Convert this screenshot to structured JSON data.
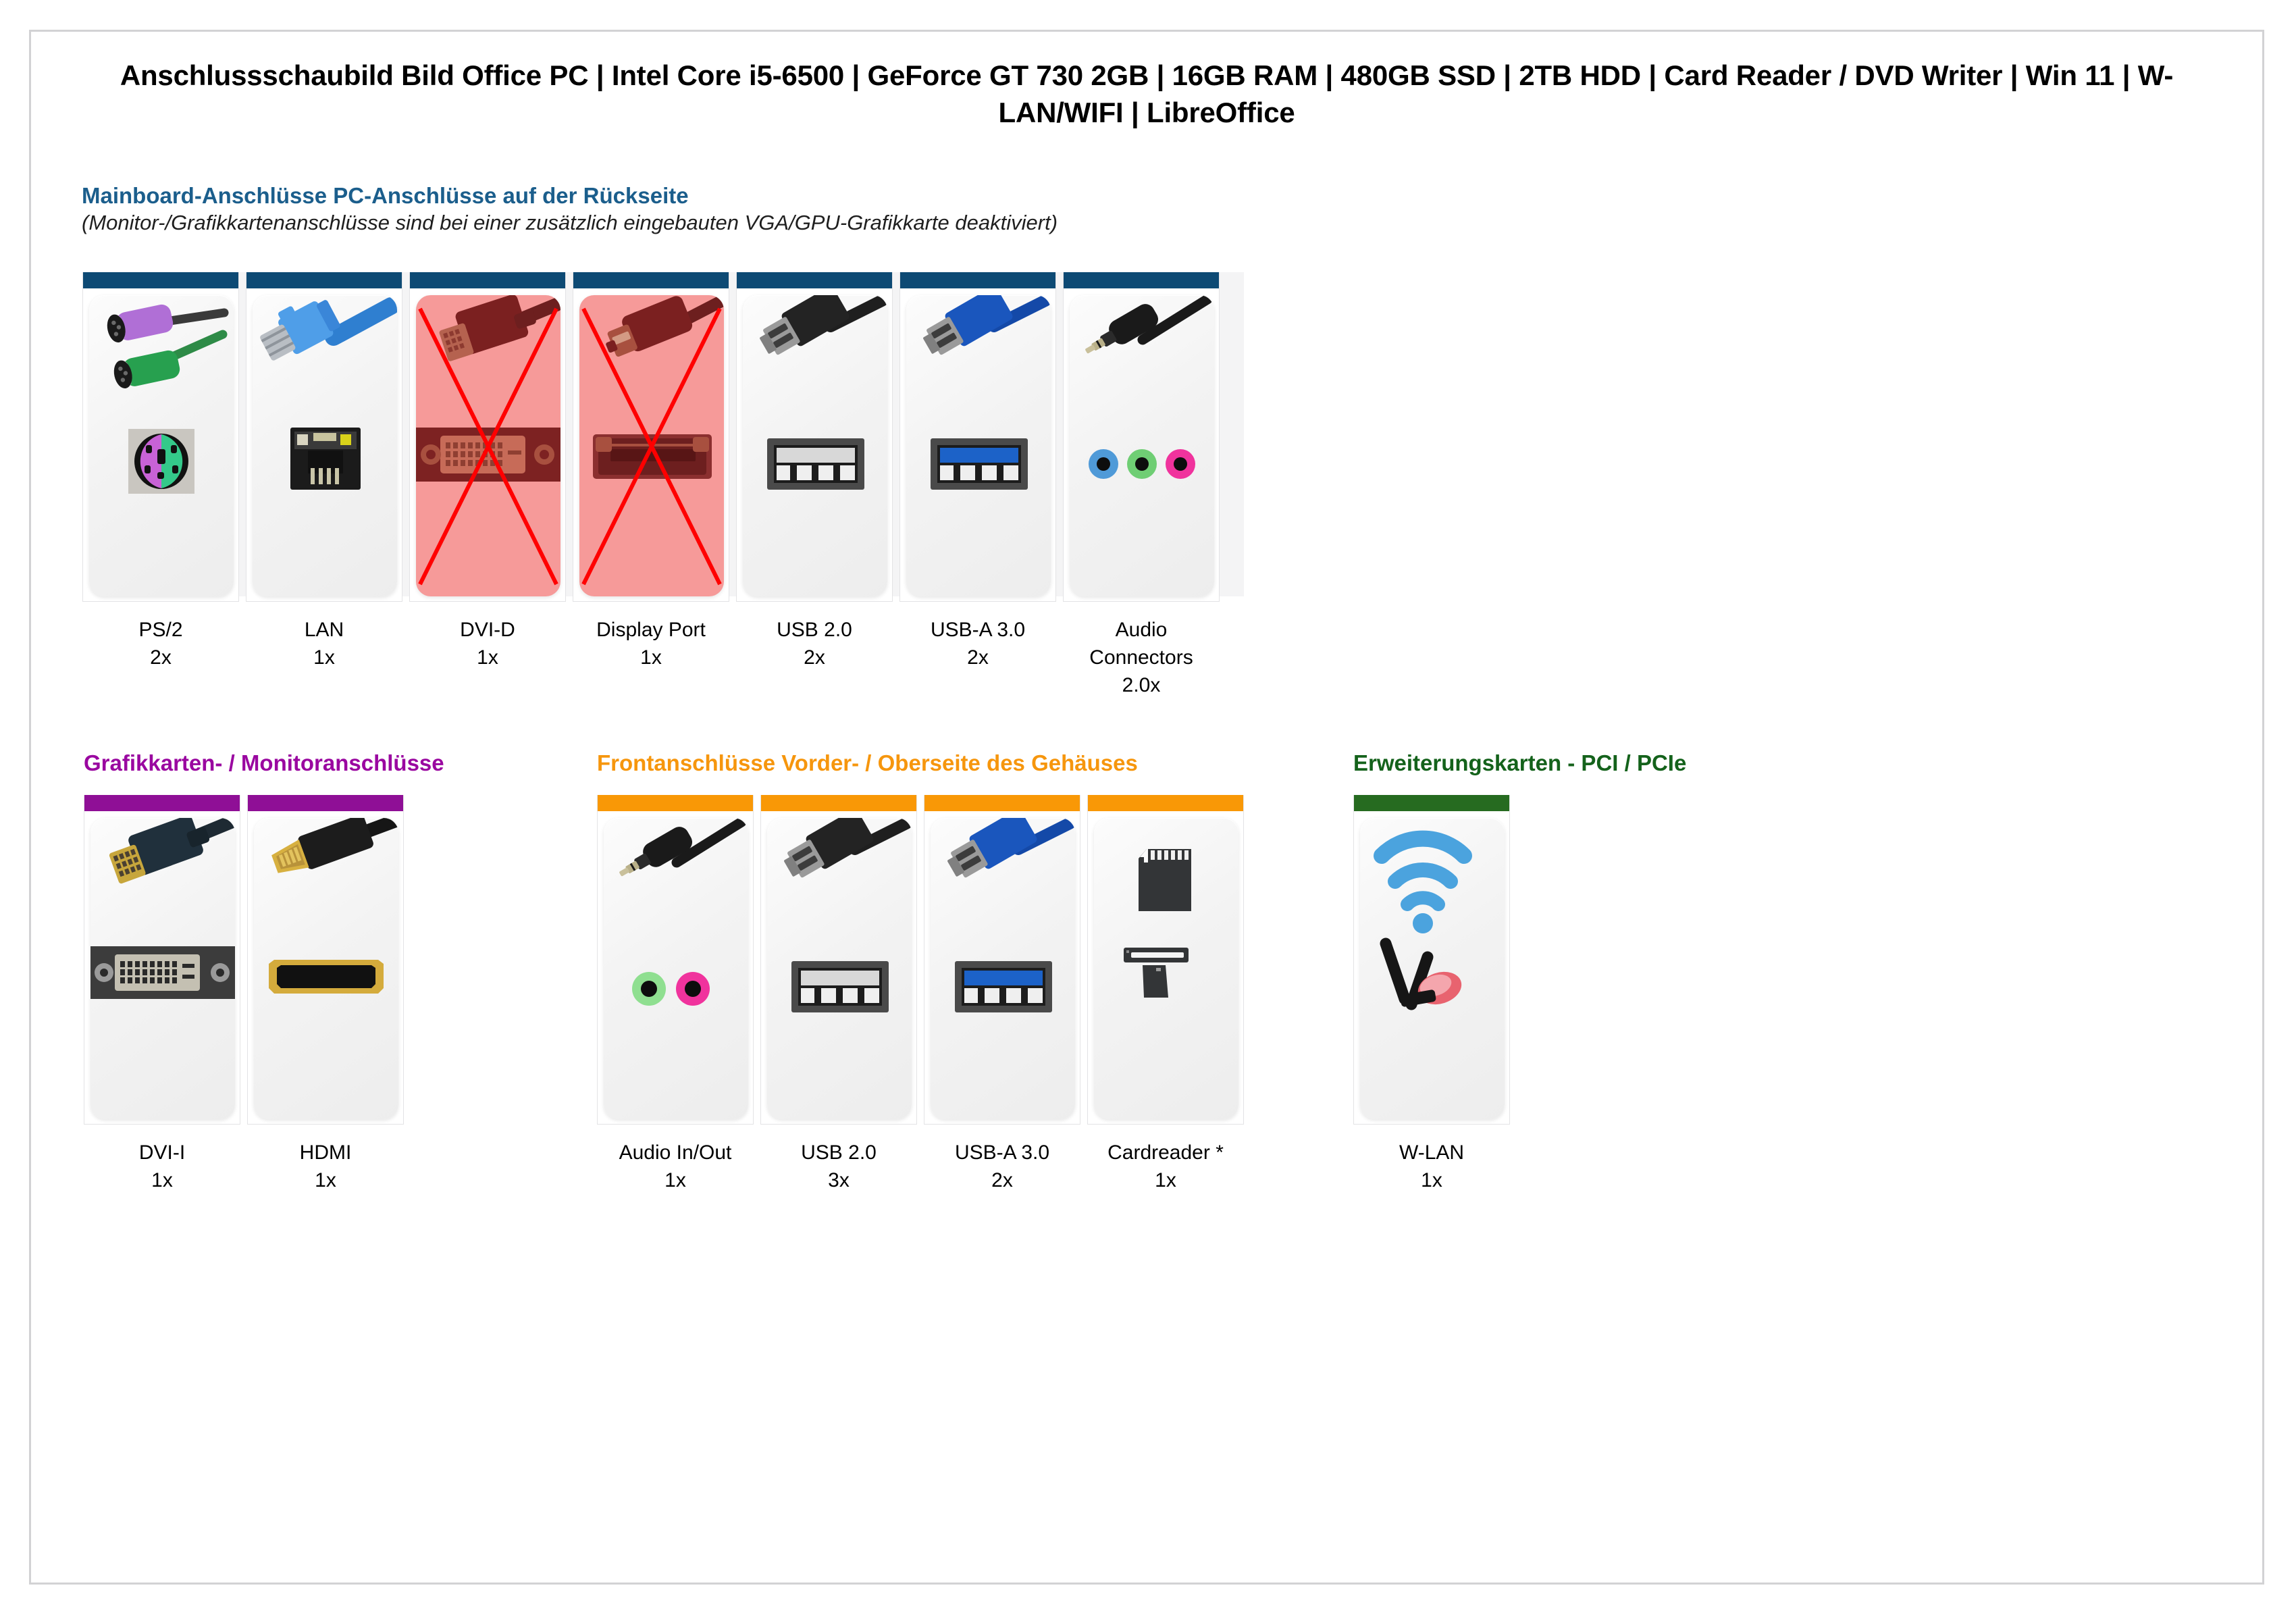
{
  "document": {
    "title": "Anschlussschaubild Bild Office PC | Intel Core i5-6500 | GeForce GT 730 2GB | 16GB RAM | 480GB SSD | 2TB HDD | Card Reader / DVD Writer | Win 11 | W-LAN/WIFI | LibreOffice"
  },
  "sections": [
    {
      "id": "mainboard",
      "heading": "Mainboard-Anschlüsse PC-Anschlüsse auf der Rückseite",
      "subheading": "(Monitor-/Grafikkartenanschlüsse sind bei einer zusätzlich eingebauten VGA/GPU-Grafikkarte deaktiviert)",
      "heading_color": "#1b5e8c",
      "accent_color": "#0d4a74",
      "ports": [
        {
          "label": "PS/2",
          "count": "2x",
          "icon": "ps2-port-icon",
          "disabled": false
        },
        {
          "label": "LAN",
          "count": "1x",
          "icon": "rj45-lan-port-icon",
          "disabled": false
        },
        {
          "label": "DVI-D",
          "count": "1x",
          "icon": "dvi-d-port-icon",
          "disabled": true
        },
        {
          "label": "Display Port",
          "count": "1x",
          "icon": "displayport-port-icon",
          "disabled": true
        },
        {
          "label": "USB 2.0",
          "count": "2x",
          "icon": "usb-a-20-port-icon",
          "disabled": false
        },
        {
          "label": "USB-A 3.0",
          "count": "2x",
          "icon": "usb-a-30-port-icon",
          "disabled": false
        },
        {
          "label": "Audio Connectors",
          "count": "2.0x",
          "icon": "audio-jacks-icon",
          "disabled": false
        }
      ]
    },
    {
      "id": "graphics",
      "heading": "Grafikkarten- / Monitoranschlüsse",
      "heading_color": "#9a07a0",
      "accent_color": "#8f0f96",
      "ports": [
        {
          "label": "DVI-I",
          "count": "1x",
          "icon": "dvi-i-port-icon",
          "disabled": false
        },
        {
          "label": "HDMI",
          "count": "1x",
          "icon": "hdmi-port-icon",
          "disabled": false
        }
      ]
    },
    {
      "id": "front",
      "heading": "Frontanschlüsse Vorder- / Oberseite des Gehäuses",
      "heading_color": "#f6960d",
      "accent_color": "#f99806",
      "ports": [
        {
          "label": "Audio In/Out",
          "count": "1x",
          "icon": "audio-in-out-jacks-icon",
          "disabled": false
        },
        {
          "label": "USB 2.0",
          "count": "3x",
          "icon": "usb-a-20-port-icon",
          "disabled": false
        },
        {
          "label": "USB-A 3.0",
          "count": "2x",
          "icon": "usb-a-30-port-icon",
          "disabled": false
        },
        {
          "label": "Cardreader *",
          "count": "1x",
          "icon": "sd-cardreader-icon",
          "disabled": false
        }
      ]
    },
    {
      "id": "expansion",
      "heading": "Erweiterungskarten - PCI / PCIe",
      "heading_color": "#14621b",
      "accent_color": "#266b20",
      "ports": [
        {
          "label": "W-LAN",
          "count": "1x",
          "icon": "wifi-antenna-icon",
          "disabled": false
        }
      ]
    }
  ]
}
